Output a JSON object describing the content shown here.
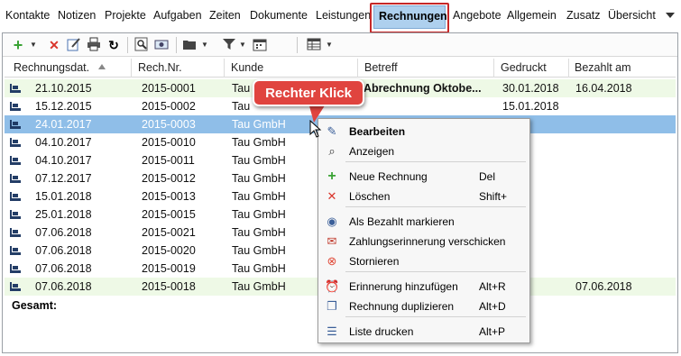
{
  "menu": {
    "items": [
      "Kontakte",
      "Notizen",
      "Projekte",
      "Aufgaben",
      "Zeiten",
      "Dokumente",
      "Leistungen",
      "Rechnungen",
      "Angebote",
      "Allgemein",
      "Zusatz",
      "Übersicht"
    ],
    "active": "Rechnungen",
    "overflow_icon": "chevron-down-icon"
  },
  "toolbar": {
    "icons": [
      "add-icon",
      "delete-icon",
      "edit-icon",
      "print-icon",
      "refresh-icon",
      "preview-icon",
      "mark-paid-icon",
      "folder-icon",
      "filter-icon",
      "calendar-icon",
      "table-icon"
    ]
  },
  "table": {
    "columns": [
      "Rechnungsdat.",
      "Rech.Nr.",
      "Kunde",
      "Betreff",
      "Gedruckt",
      "Bezahlt am"
    ],
    "rows": [
      {
        "date": "21.10.2015",
        "nr": "2015-0001",
        "kunde": "Tau",
        "betreff": "Abrechnung Oktobe...",
        "gedruckt": "30.01.2018",
        "bezahlt": "16.04.2018",
        "state": "paid"
      },
      {
        "date": "15.12.2015",
        "nr": "2015-0002",
        "kunde": "Tau",
        "betreff": "",
        "gedruckt": "15.01.2018",
        "bezahlt": "",
        "state": "normal"
      },
      {
        "date": "24.01.2017",
        "nr": "2015-0003",
        "kunde": "Tau GmbH",
        "betreff": "",
        "gedruckt": "2017",
        "bezahlt": "",
        "state": "selected"
      },
      {
        "date": "04.10.2017",
        "nr": "2015-0010",
        "kunde": "Tau GmbH",
        "betreff": "",
        "gedruckt": "",
        "bezahlt": "",
        "state": "normal"
      },
      {
        "date": "04.10.2017",
        "nr": "2015-0011",
        "kunde": "Tau GmbH",
        "betreff": "",
        "gedruckt": "",
        "bezahlt": "",
        "state": "normal"
      },
      {
        "date": "07.12.2017",
        "nr": "2015-0012",
        "kunde": "Tau GmbH",
        "betreff": "",
        "gedruckt": "",
        "bezahlt": "",
        "state": "normal"
      },
      {
        "date": "15.01.2018",
        "nr": "2015-0013",
        "kunde": "Tau GmbH",
        "betreff": "",
        "gedruckt": "",
        "bezahlt": "",
        "state": "normal"
      },
      {
        "date": "25.01.2018",
        "nr": "2015-0015",
        "kunde": "Tau GmbH",
        "betreff": "",
        "gedruckt": "2018",
        "bezahlt": "",
        "state": "normal"
      },
      {
        "date": "07.06.2018",
        "nr": "2015-0021",
        "kunde": "Tau GmbH",
        "betreff": "",
        "gedruckt": "2018",
        "bezahlt": "",
        "state": "normal"
      },
      {
        "date": "07.06.2018",
        "nr": "2015-0020",
        "kunde": "Tau GmbH",
        "betreff": "",
        "gedruckt": "",
        "bezahlt": "",
        "state": "normal"
      },
      {
        "date": "07.06.2018",
        "nr": "2015-0019",
        "kunde": "Tau GmbH",
        "betreff": "",
        "gedruckt": "2018",
        "bezahlt": "",
        "state": "normal"
      },
      {
        "date": "07.06.2018",
        "nr": "2015-0018",
        "kunde": "Tau GmbH",
        "betreff": "",
        "gedruckt": "2018",
        "bezahlt": "07.06.2018",
        "state": "paid"
      }
    ],
    "total_label": "Gesamt:"
  },
  "context_menu": {
    "items": [
      {
        "label": "Bearbeiten",
        "shortcut": "",
        "icon": "edit-icon",
        "bold": true
      },
      {
        "label": "Anzeigen",
        "shortcut": "",
        "icon": "preview-icon",
        "bold": false
      },
      {
        "label": "Neue Rechnung",
        "shortcut": "Del",
        "icon": "add-icon",
        "bold": false
      },
      {
        "label": "Löschen",
        "shortcut": "Shift+",
        "icon": "delete-icon",
        "bold": false
      },
      {
        "label": "Als Bezahlt markieren",
        "shortcut": "",
        "icon": "mark-paid-icon",
        "bold": false
      },
      {
        "label": "Zahlungserinnerung verschicken",
        "shortcut": "",
        "icon": "reminder-send-icon",
        "bold": false
      },
      {
        "label": "Stornieren",
        "shortcut": "",
        "icon": "cancel-icon",
        "bold": false
      },
      {
        "label": "Erinnerung hinzufügen",
        "shortcut": "Alt+R",
        "icon": "alarm-icon",
        "bold": false
      },
      {
        "label": "Rechnung duplizieren",
        "shortcut": "Alt+D",
        "icon": "duplicate-icon",
        "bold": false
      },
      {
        "label": "Liste drucken",
        "shortcut": "Alt+P",
        "icon": "print-list-icon",
        "bold": false
      }
    ]
  },
  "callout": {
    "text": "Rechter Klick"
  },
  "colors": {
    "accent_highlight": "#8fbee8",
    "menu_active_bg": "#aed0ee",
    "menu_active_frame": "#c62828",
    "paid_row_bg": "#eef9e6",
    "callout_bg": "#e0443f"
  }
}
